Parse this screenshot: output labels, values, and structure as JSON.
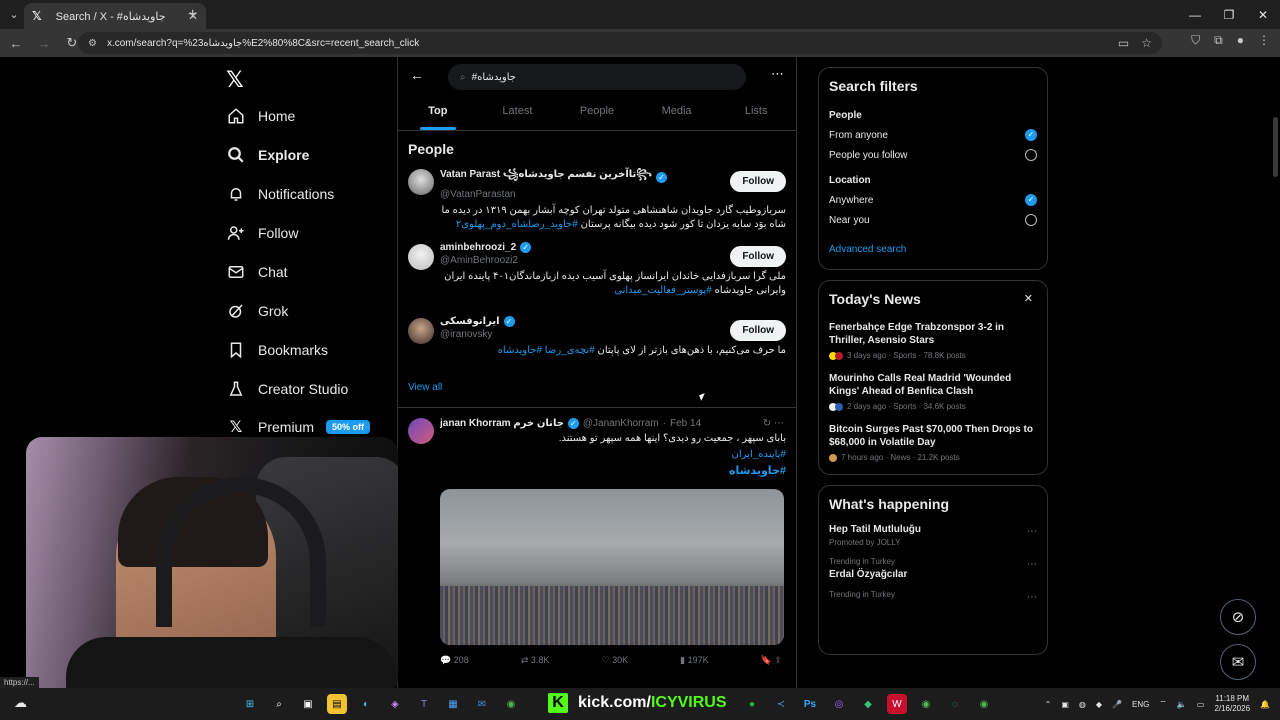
{
  "browser": {
    "tab_title": "Search / X - #جاویدشاه",
    "url": "x.com/search?q=%23جاویدشاه%E2%80%8C&src=recent_search_click",
    "status_url": "https://..."
  },
  "nav": {
    "items": [
      {
        "label": "Home",
        "icon": "home-icon"
      },
      {
        "label": "Explore",
        "icon": "search-icon"
      },
      {
        "label": "Notifications",
        "icon": "bell-icon"
      },
      {
        "label": "Follow",
        "icon": "person-add-icon"
      },
      {
        "label": "Chat",
        "icon": "mail-icon"
      },
      {
        "label": "Grok",
        "icon": "grok-icon"
      },
      {
        "label": "Bookmarks",
        "icon": "bookmark-icon"
      },
      {
        "label": "Creator Studio",
        "icon": "flask-icon"
      },
      {
        "label": "Premium",
        "icon": "x-icon",
        "badge": "50% off"
      }
    ]
  },
  "search": {
    "query": "#جاویدشاه",
    "tabs": [
      "Top",
      "Latest",
      "People",
      "Media",
      "Lists"
    ]
  },
  "people": {
    "title": "People",
    "follow_label": "Follow",
    "view_all": "View all",
    "list": [
      {
        "name": "Vatan Parast ꧁تاآخرین نفسم جاویدشاه꧂",
        "handle": "@VatanParastan",
        "bio": "سربازوطیب گارد جاویدان شاهنشاهی متولد تهران کوچه آبشار بهمن ۱۳۱۹ در دیده ما شاه بوَد سایه یزدان تا کور شود دیده بیگانه پرستان",
        "bio_link": "#جاوید_رضاشاه_دوم_پهلوی۲"
      },
      {
        "name": "aminbehroozi_2",
        "handle": "@AminBehroozi2",
        "bio": "ملی گرا سربازفدایی خاندان ایرانساز پهلوی آسیب دیده ازبازماندگان۴۰۱ پاینده ایران وایرانی جاویدشاه",
        "bio_link": "#پوستر_فعالیت_میدانی"
      },
      {
        "name": "ایرانوفسکی",
        "handle": "@iranovsky",
        "bio": "ما حرف می‌کنیم، با ذهن‌های بازتر از لای پاپتان",
        "bio_link": "#نچه‌ی_رضا #جاویدشاه"
      }
    ]
  },
  "post": {
    "name": "janan Khorram جانان خرم",
    "handle": "@JananKhorram",
    "date": "Feb 14",
    "text": "بابای سپهر ، جمعیت رو دیدی؟ اینها همه سپهر تو هستند.",
    "link1": "#پاینده_ایران",
    "link2": "#جاویدشاه",
    "replies": "208",
    "reposts": "3.8K",
    "likes": "30K",
    "views": "197K"
  },
  "filters": {
    "title": "Search filters",
    "people_label": "People",
    "people_options": [
      "From anyone",
      "People you follow"
    ],
    "location_label": "Location",
    "location_options": [
      "Anywhere",
      "Near you"
    ],
    "advanced": "Advanced search"
  },
  "news": {
    "title": "Today's News",
    "items": [
      {
        "title": "Fenerbahçe Edge Trabzonspor 3-2 in Thriller, Asensio Stars",
        "meta": "3 days ago · Sports · 78.8K posts"
      },
      {
        "title": "Mourinho Calls Real Madrid 'Wounded Kings' Ahead of Benfica Clash",
        "meta": "2 days ago · Sports · 34.6K posts"
      },
      {
        "title": "Bitcoin Surges Past $70,000 Then Drops to $68,000 in Volatile Day",
        "meta": "7 hours ago · News · 21.2K posts"
      }
    ]
  },
  "happening": {
    "title": "What's happening",
    "items": [
      {
        "context": "Promoted by JOLLY",
        "name": "Hep Tatil Mutluluğu",
        "promoted": true
      },
      {
        "context": "Trending in Turkey",
        "name": "Erdal Özyağcılar"
      },
      {
        "context": "Trending in Turkey",
        "name": ""
      }
    ]
  },
  "taskbar": {
    "kick_prefix": "kick.com/",
    "kick_user": "ICYVIRUS",
    "lang": "ENG",
    "time": "11:18 PM",
    "date": "2/16/2026"
  }
}
